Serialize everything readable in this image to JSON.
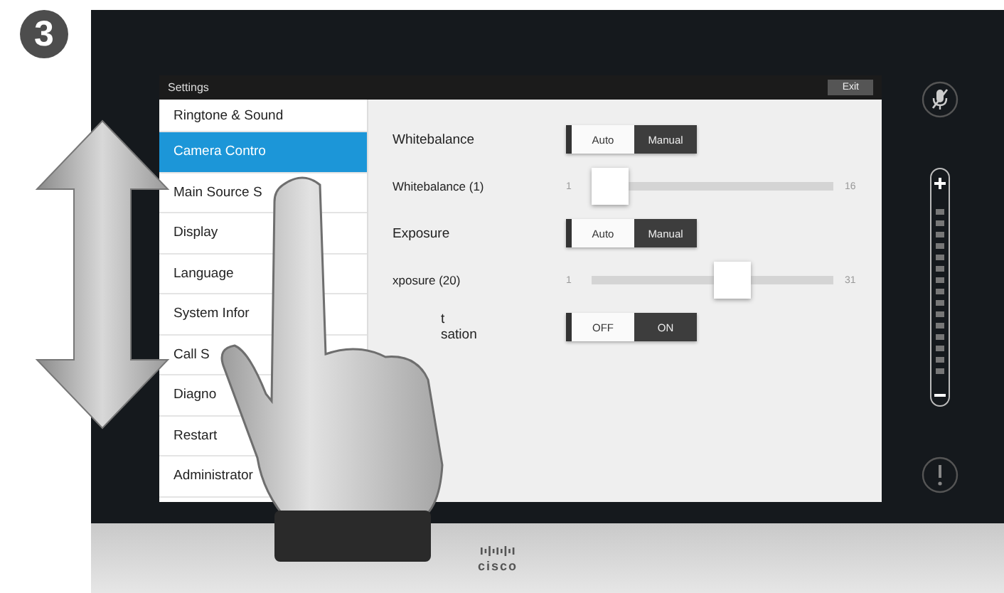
{
  "step_badge": "3",
  "panel": {
    "title": "Settings",
    "exit_button": "Exit"
  },
  "sidebar": {
    "items": [
      {
        "label": "Ringtone & Sound",
        "selected": false
      },
      {
        "label": "Camera Contro",
        "selected": true
      },
      {
        "label": "Main Source S",
        "selected": false
      },
      {
        "label": "Display",
        "selected": false
      },
      {
        "label": "Language",
        "selected": false
      },
      {
        "label": "System Infor",
        "selected": false
      },
      {
        "label": "Call S",
        "selected": false
      },
      {
        "label": "Diagno",
        "selected": false
      },
      {
        "label": "Restart",
        "selected": false
      },
      {
        "label": "Administrator",
        "selected": false
      }
    ]
  },
  "settings": [
    {
      "kind": "toggle",
      "label": "Whitebalance",
      "options": [
        {
          "label": "Auto",
          "selected": false
        },
        {
          "label": "Manual",
          "selected": true
        }
      ]
    },
    {
      "kind": "slider",
      "label": "Whitebalance (1)",
      "min": "1",
      "max": "16",
      "level": 0
    },
    {
      "kind": "toggle",
      "label": "Exposure",
      "options": [
        {
          "label": "Auto",
          "selected": false
        },
        {
          "label": "Manual",
          "selected": true
        }
      ]
    },
    {
      "kind": "slider",
      "label": "xposure (20)",
      "min": "1",
      "max": "31",
      "level": 0.63
    },
    {
      "kind": "toggle",
      "label_lines": [
        "t",
        "sation"
      ],
      "options": [
        {
          "label": "OFF",
          "selected": false
        },
        {
          "label": "ON",
          "selected": true
        }
      ]
    }
  ],
  "brand": "cisco"
}
